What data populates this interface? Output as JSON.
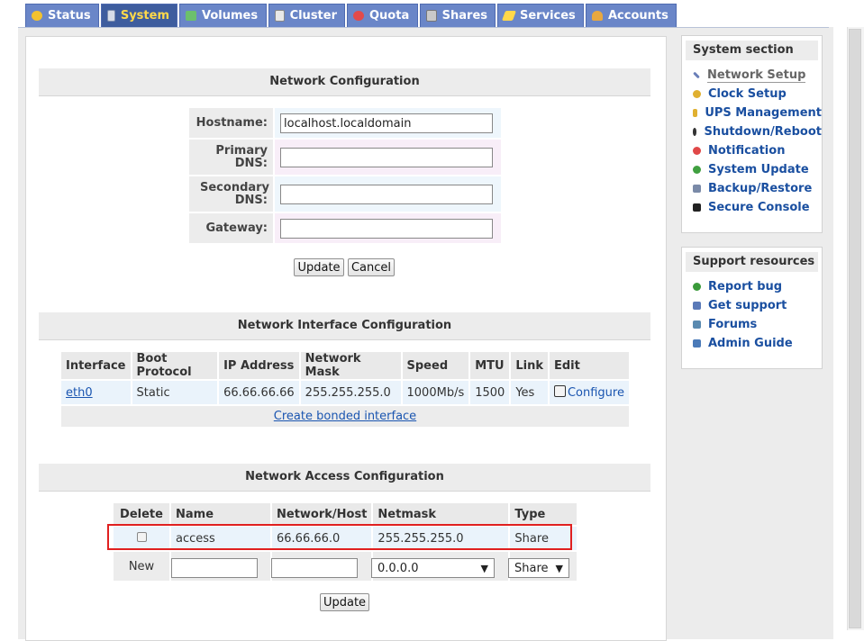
{
  "tabs": [
    {
      "label": "Status",
      "icon": "status-icon",
      "color": "#f2c230"
    },
    {
      "label": "System",
      "icon": "system-icon",
      "color": "#d6dce8",
      "active": true
    },
    {
      "label": "Volumes",
      "icon": "volumes-icon",
      "color": "#6cc06c"
    },
    {
      "label": "Cluster",
      "icon": "cluster-icon",
      "color": "#e8e8e8"
    },
    {
      "label": "Quota",
      "icon": "quota-icon",
      "color": "#e24a4a"
    },
    {
      "label": "Shares",
      "icon": "shares-icon",
      "color": "#c9c9c9"
    },
    {
      "label": "Services",
      "icon": "services-icon",
      "color": "#ffd84a"
    },
    {
      "label": "Accounts",
      "icon": "accounts-icon",
      "color": "#e8a840"
    }
  ],
  "network_config": {
    "title": "Network Configuration",
    "hostname_label": "Hostname:",
    "hostname_value": "localhost.localdomain",
    "primary_dns_label": "Primary DNS:",
    "primary_dns_value": "",
    "secondary_dns_label": "Secondary DNS:",
    "secondary_dns_value": "",
    "gateway_label": "Gateway:",
    "gateway_value": "",
    "update_label": "Update",
    "cancel_label": "Cancel"
  },
  "interface_config": {
    "title": "Network Interface Configuration",
    "columns": [
      "Interface",
      "Boot Protocol",
      "IP Address",
      "Network Mask",
      "Speed",
      "MTU",
      "Link",
      "Edit"
    ],
    "rows": [
      {
        "interface": "eth0",
        "boot_protocol": "Static",
        "ip_address": "66.66.66.66",
        "network_mask": "255.255.255.0",
        "speed": "1000Mb/s",
        "mtu": "1500",
        "link": "Yes",
        "edit": "Configure"
      }
    ],
    "bond_link": "Create bonded interface"
  },
  "access_config": {
    "title": "Network Access Configuration",
    "columns": [
      "Delete",
      "Name",
      "Network/Host",
      "Netmask",
      "Type"
    ],
    "rows": [
      {
        "name": "access",
        "network": "66.66.66.0",
        "netmask": "255.255.255.0",
        "type": "Share"
      }
    ],
    "new_label": "New",
    "new_netmask": "0.0.0.0",
    "new_type": "Share",
    "update_label": "Update"
  },
  "sidebar": {
    "system_title": "System section",
    "system_items": [
      {
        "label": "Network Setup",
        "icon": "network-setup-icon",
        "color": "#6a7fb8",
        "current": true
      },
      {
        "label": "Clock Setup",
        "icon": "clock-icon",
        "color": "#e0b030"
      },
      {
        "label": "UPS Management",
        "icon": "ups-icon",
        "color": "#e0b030"
      },
      {
        "label": "Shutdown/Reboot",
        "icon": "power-icon",
        "color": "#333333"
      },
      {
        "label": "Notification",
        "icon": "notification-icon",
        "color": "#e04848"
      },
      {
        "label": "System Update",
        "icon": "update-icon",
        "color": "#40a040"
      },
      {
        "label": "Backup/Restore",
        "icon": "backup-icon",
        "color": "#7a8aa8"
      },
      {
        "label": "Secure Console",
        "icon": "console-icon",
        "color": "#222222"
      }
    ],
    "support_title": "Support resources",
    "support_items": [
      {
        "label": "Report bug",
        "icon": "bug-icon",
        "color": "#3a9a3a"
      },
      {
        "label": "Get support",
        "icon": "support-icon",
        "color": "#5a7ab8"
      },
      {
        "label": "Forums",
        "icon": "forums-icon",
        "color": "#5a8ab0"
      },
      {
        "label": "Admin Guide",
        "icon": "guide-icon",
        "color": "#4a7ab8"
      }
    ]
  }
}
